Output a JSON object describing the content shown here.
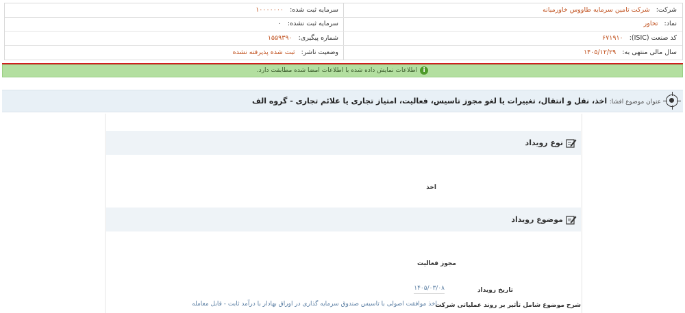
{
  "info": {
    "company_label": "شرکت:",
    "company_value": "شرکت تامین سرمایه طاووس خاورمیانه",
    "capital_label": "سرمایه ثبت شده:",
    "capital_value": "۱۰۰۰۰۰۰۰",
    "symbol_label": "نماد:",
    "symbol_value": "تخاور",
    "unreg_capital_label": "سرمایه ثبت نشده:",
    "unreg_capital_value": "۰",
    "isic_label": "کد صنعت (ISIC):",
    "isic_value": "۶۷۱۹۱۰",
    "tracking_label": "شماره پیگیری:",
    "tracking_value": "۱۵۵۹۳۹۰",
    "fiscal_label": "سال مالی منتهی به:",
    "fiscal_value": "۱۴۰۵/۱۲/۲۹",
    "publisher_status_label": "وضعیت ناشر:",
    "publisher_status_value": "ثبت شده پذیرفته نشده"
  },
  "alert": {
    "text": "اطلاعات نمایش داده شده با اطلاعات امضا شده مطابقت دارد.",
    "icon": "info-icon"
  },
  "header": {
    "prefix": "عنوان موضوع افشا:",
    "title": "اخذ، نقل و انتقال، تغییرات یا لغو مجوز تاسیس، فعالیت، امتیاز تجاری یا علائم تجاری - گروه الف"
  },
  "sections": {
    "event_type_title": "نوع رویداد",
    "event_type_value": "اخذ",
    "event_subject_title": "موضوع رویداد",
    "event_subject_value": "مجوز فعالیت",
    "event_date_label": "تاریخ رویداد",
    "event_date_value": "۱۴۰۵/۰۳/۰۸",
    "impact_label": "شرح موضوع شامل تأثیر بر روند عملیاتی شرکت",
    "impact_value": "اخذ موافقت اصولی با تاسیس صندوق سرمایه گذاری در اوراق بهادار با درآمد ثابت - قابل معامله"
  },
  "colors": {
    "accent_value": "#c0501d",
    "success_bg": "#b3dfa0",
    "header_bg": "#e8f0f6",
    "divider_red": "#d01f1f",
    "link": "#5a7ea3"
  }
}
